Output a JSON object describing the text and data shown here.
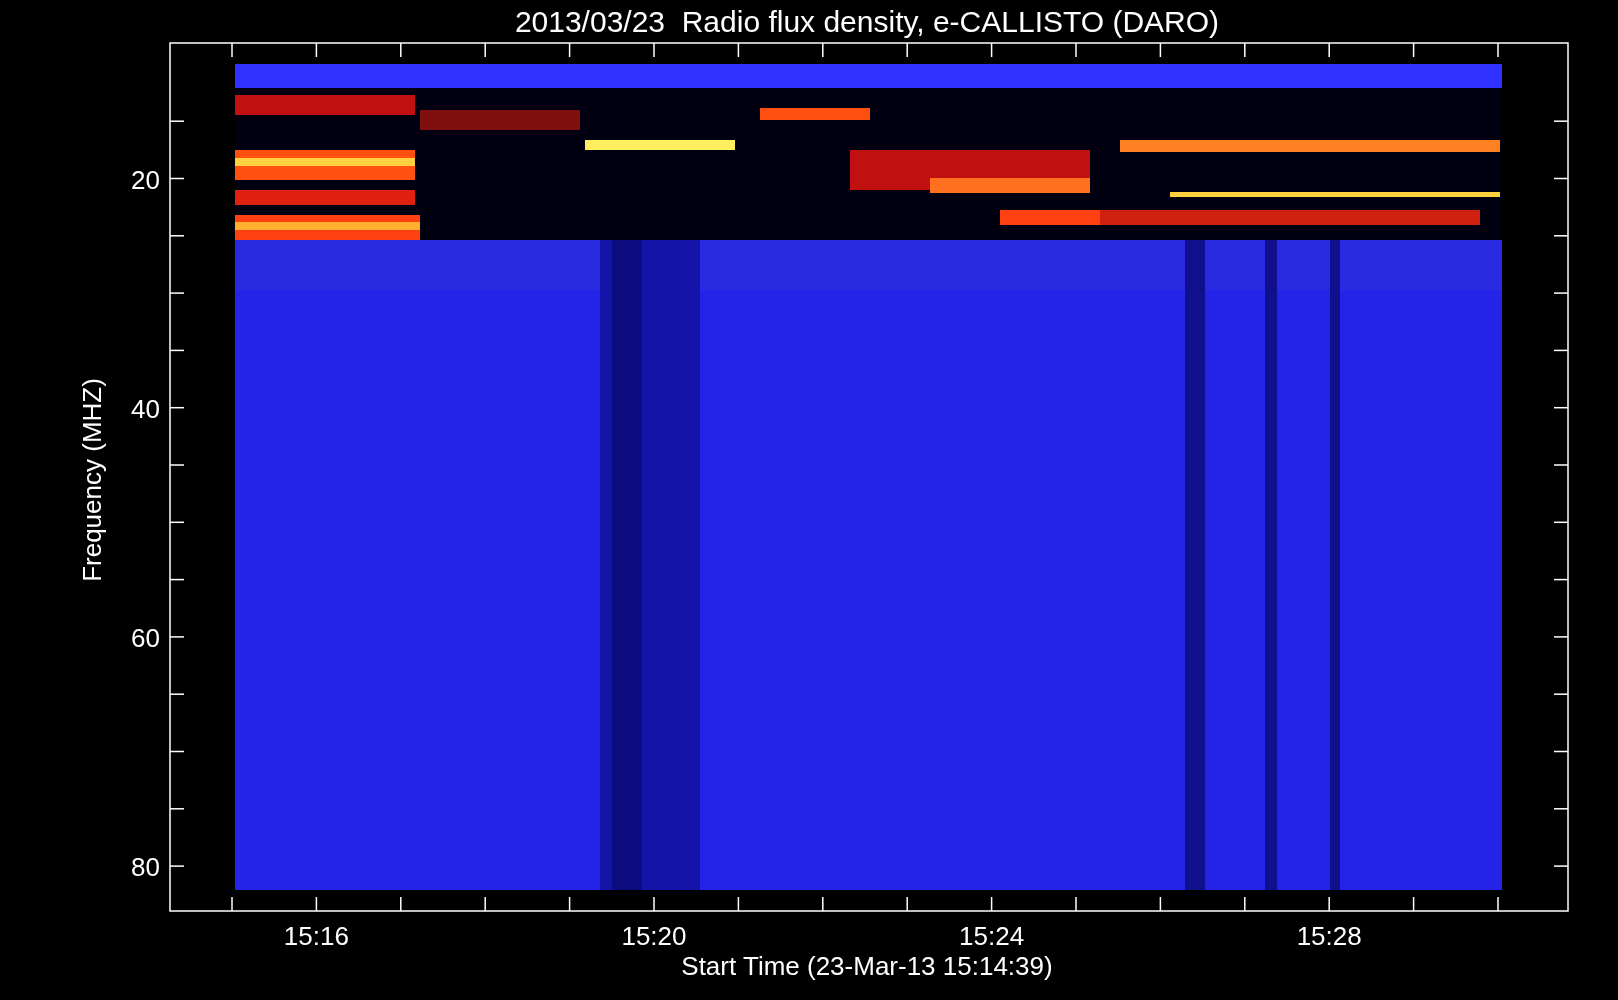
{
  "plot": {
    "title": "2013/03/23  Radio flux density, e-CALLISTO (DARO)",
    "xlabel": "Start Time (23-Mar-13 15:14:39)",
    "ylabel": "Frequency (MHZ)",
    "xtick_labels": [
      "15:16",
      "15:20",
      "15:24",
      "15:28"
    ],
    "ytick_labels": [
      "20",
      "40",
      "60",
      "80"
    ]
  }
}
